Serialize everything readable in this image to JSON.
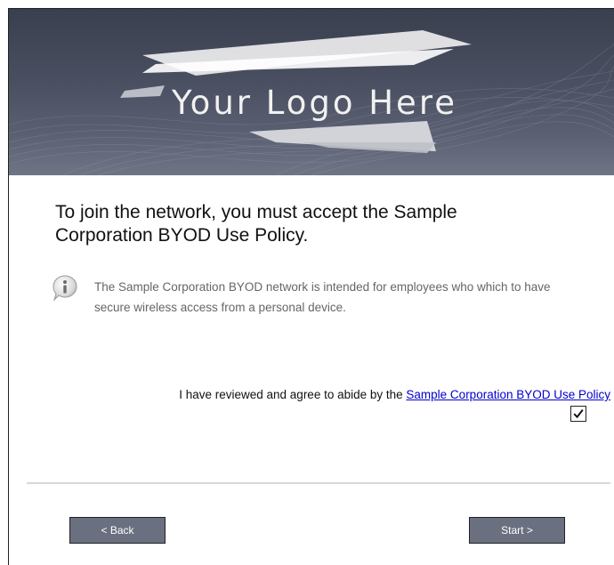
{
  "banner": {
    "logo_text": "Your Logo Here",
    "icon": "abstract-wave-banner"
  },
  "heading": "To join the network, you must accept the Sample Corporation BYOD Use Policy.",
  "info": {
    "icon": "info-icon",
    "text": "The Sample Corporation BYOD network is intended for employees who which to have secure wireless access from a personal device."
  },
  "agreement": {
    "prefix": "I have reviewed and agree to abide by the ",
    "link_text": "Sample Corporation BYOD Use Policy",
    "checked": true,
    "check_glyph": "☑"
  },
  "buttons": {
    "back_label": "< Back",
    "start_label": "Start >"
  },
  "colors": {
    "banner": "#4a5061",
    "button": "#6b7080",
    "link": "#0000cc"
  }
}
